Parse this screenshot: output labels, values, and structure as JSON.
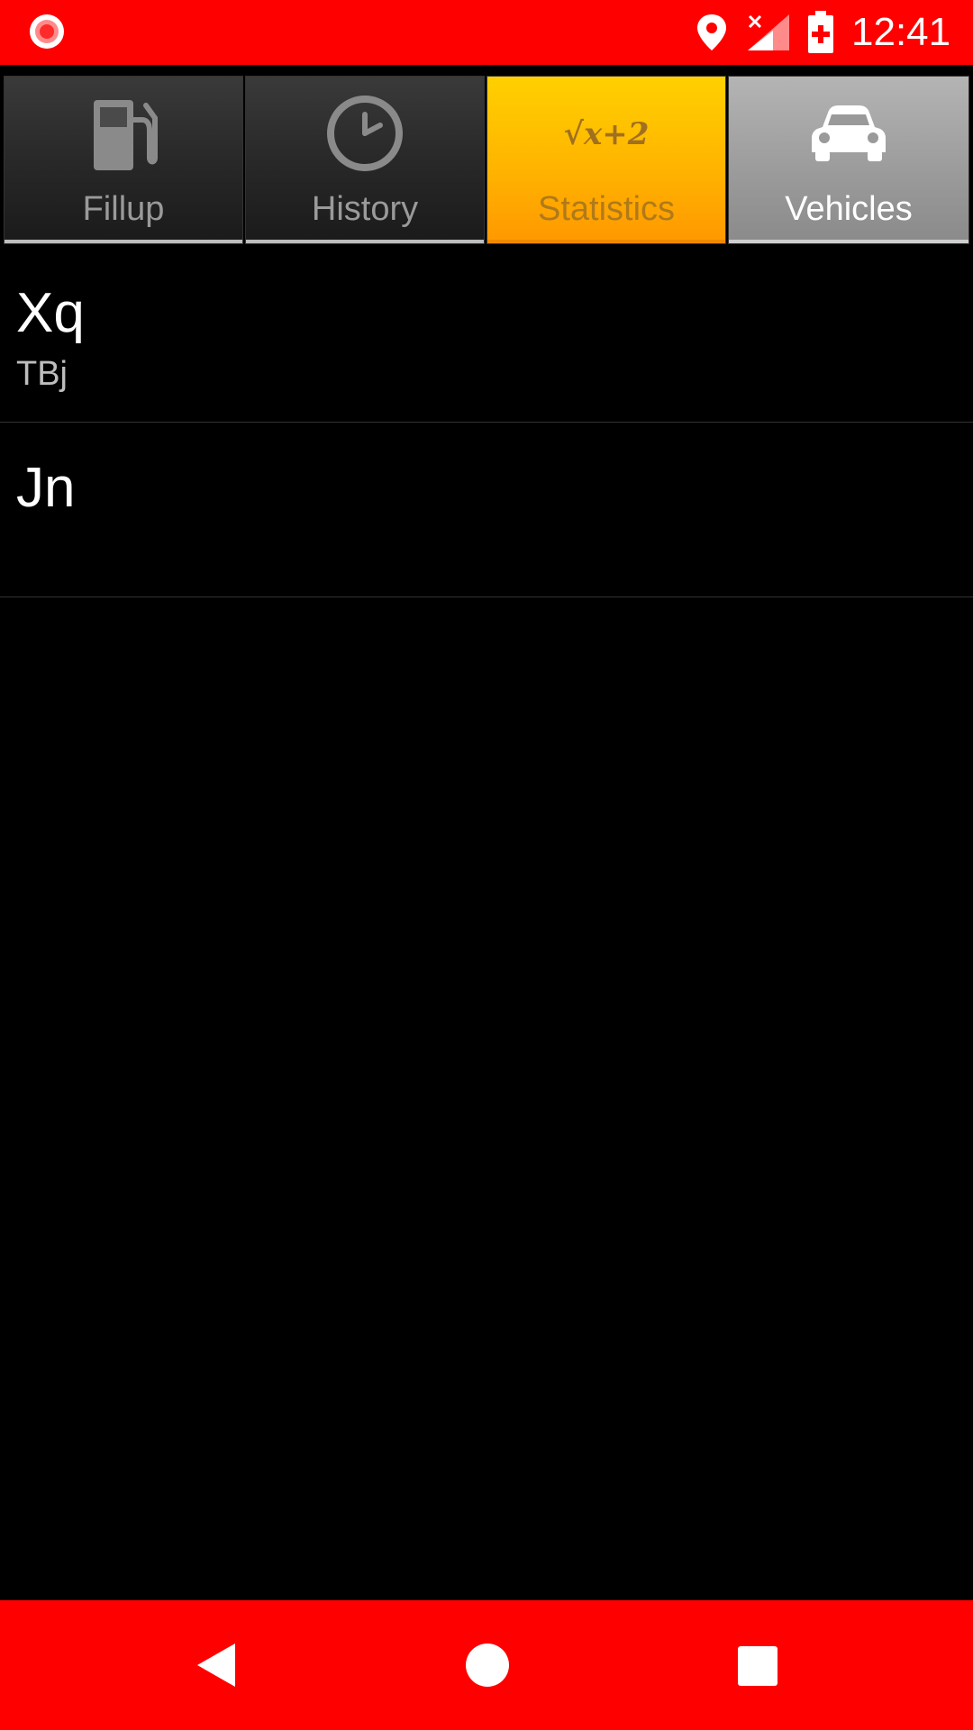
{
  "status_bar": {
    "time": "12:41",
    "icons": [
      "record-icon",
      "location-icon",
      "signal-icon",
      "battery-icon"
    ],
    "background": "#ff0000"
  },
  "tabs": [
    {
      "label": "Fillup",
      "icon": "fuel-pump-icon",
      "state": "inactive"
    },
    {
      "label": "History",
      "icon": "clock-icon",
      "state": "inactive"
    },
    {
      "label": "Statistics",
      "icon": "formula-icon",
      "formula": "√x+2",
      "state": "highlighted"
    },
    {
      "label": "Vehicles",
      "icon": "car-icon",
      "state": "selected"
    }
  ],
  "vehicles": [
    {
      "name": "Xq",
      "detail": "TBj"
    },
    {
      "name": "Jn",
      "detail": ""
    }
  ],
  "nav_bar": {
    "icons": [
      "back-icon",
      "home-icon",
      "recents-icon"
    ],
    "background": "#ff0000"
  },
  "colors": {
    "accent_red": "#ff0000",
    "tab_highlight": "#ffb400",
    "tab_selected": "#9a9a9a"
  }
}
